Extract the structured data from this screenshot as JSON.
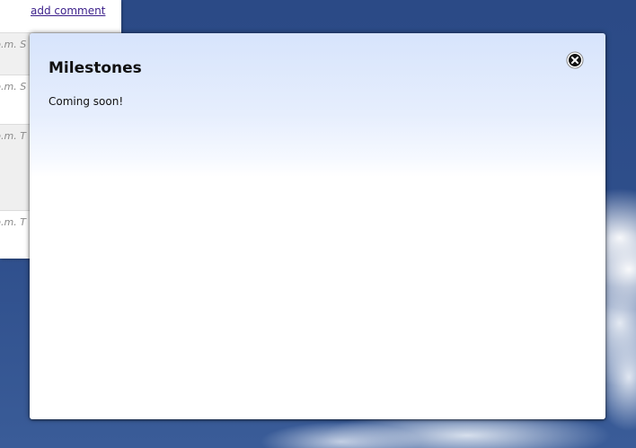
{
  "background": {
    "sky_color": "#2d4b86"
  },
  "underlying_page": {
    "add_comment_link": "add comment",
    "feed_rows": [
      {
        "timestamp_fragment": "p.m. S"
      },
      {
        "timestamp_fragment": "p.m. S"
      },
      {
        "timestamp_fragment": "p.m. T"
      },
      {
        "timestamp_fragment": "p.m. T"
      }
    ]
  },
  "modal": {
    "title": "Milestones",
    "body": "Coming soon!",
    "close_icon": "close-circle-x",
    "gradient_top_color": "#d7e4fc"
  }
}
